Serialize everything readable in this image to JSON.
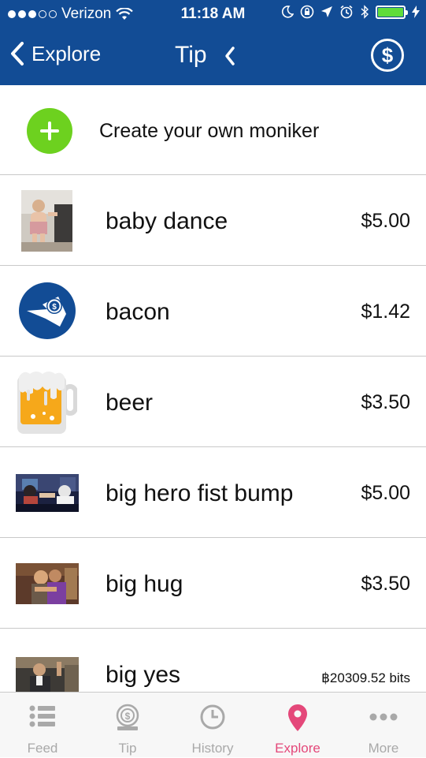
{
  "status_bar": {
    "carrier": "Verizon",
    "time": "11:18 AM"
  },
  "nav": {
    "back_label": "Explore",
    "title": "Tip"
  },
  "create": {
    "label": "Create your own moniker"
  },
  "items": [
    {
      "name": "baby dance",
      "price": "$5.00"
    },
    {
      "name": "bacon",
      "price": "$1.42"
    },
    {
      "name": "beer",
      "price": "$3.50"
    },
    {
      "name": "big hero fist bump",
      "price": "$5.00"
    },
    {
      "name": "big hug",
      "price": "$3.50"
    },
    {
      "name": "big yes",
      "price": "฿20309.52 bits"
    }
  ],
  "tabs": [
    {
      "label": "Feed",
      "icon": "list-icon"
    },
    {
      "label": "Tip",
      "icon": "tip-jar-icon"
    },
    {
      "label": "History",
      "icon": "clock-icon"
    },
    {
      "label": "Explore",
      "icon": "location-pin-icon",
      "active": true
    },
    {
      "label": "More",
      "icon": "ellipsis-icon"
    }
  ],
  "colors": {
    "brand_blue": "#124c95",
    "create_green": "#6dd11f",
    "active_tab": "#e4487a",
    "inactive_tab": "#a9a9a9"
  }
}
